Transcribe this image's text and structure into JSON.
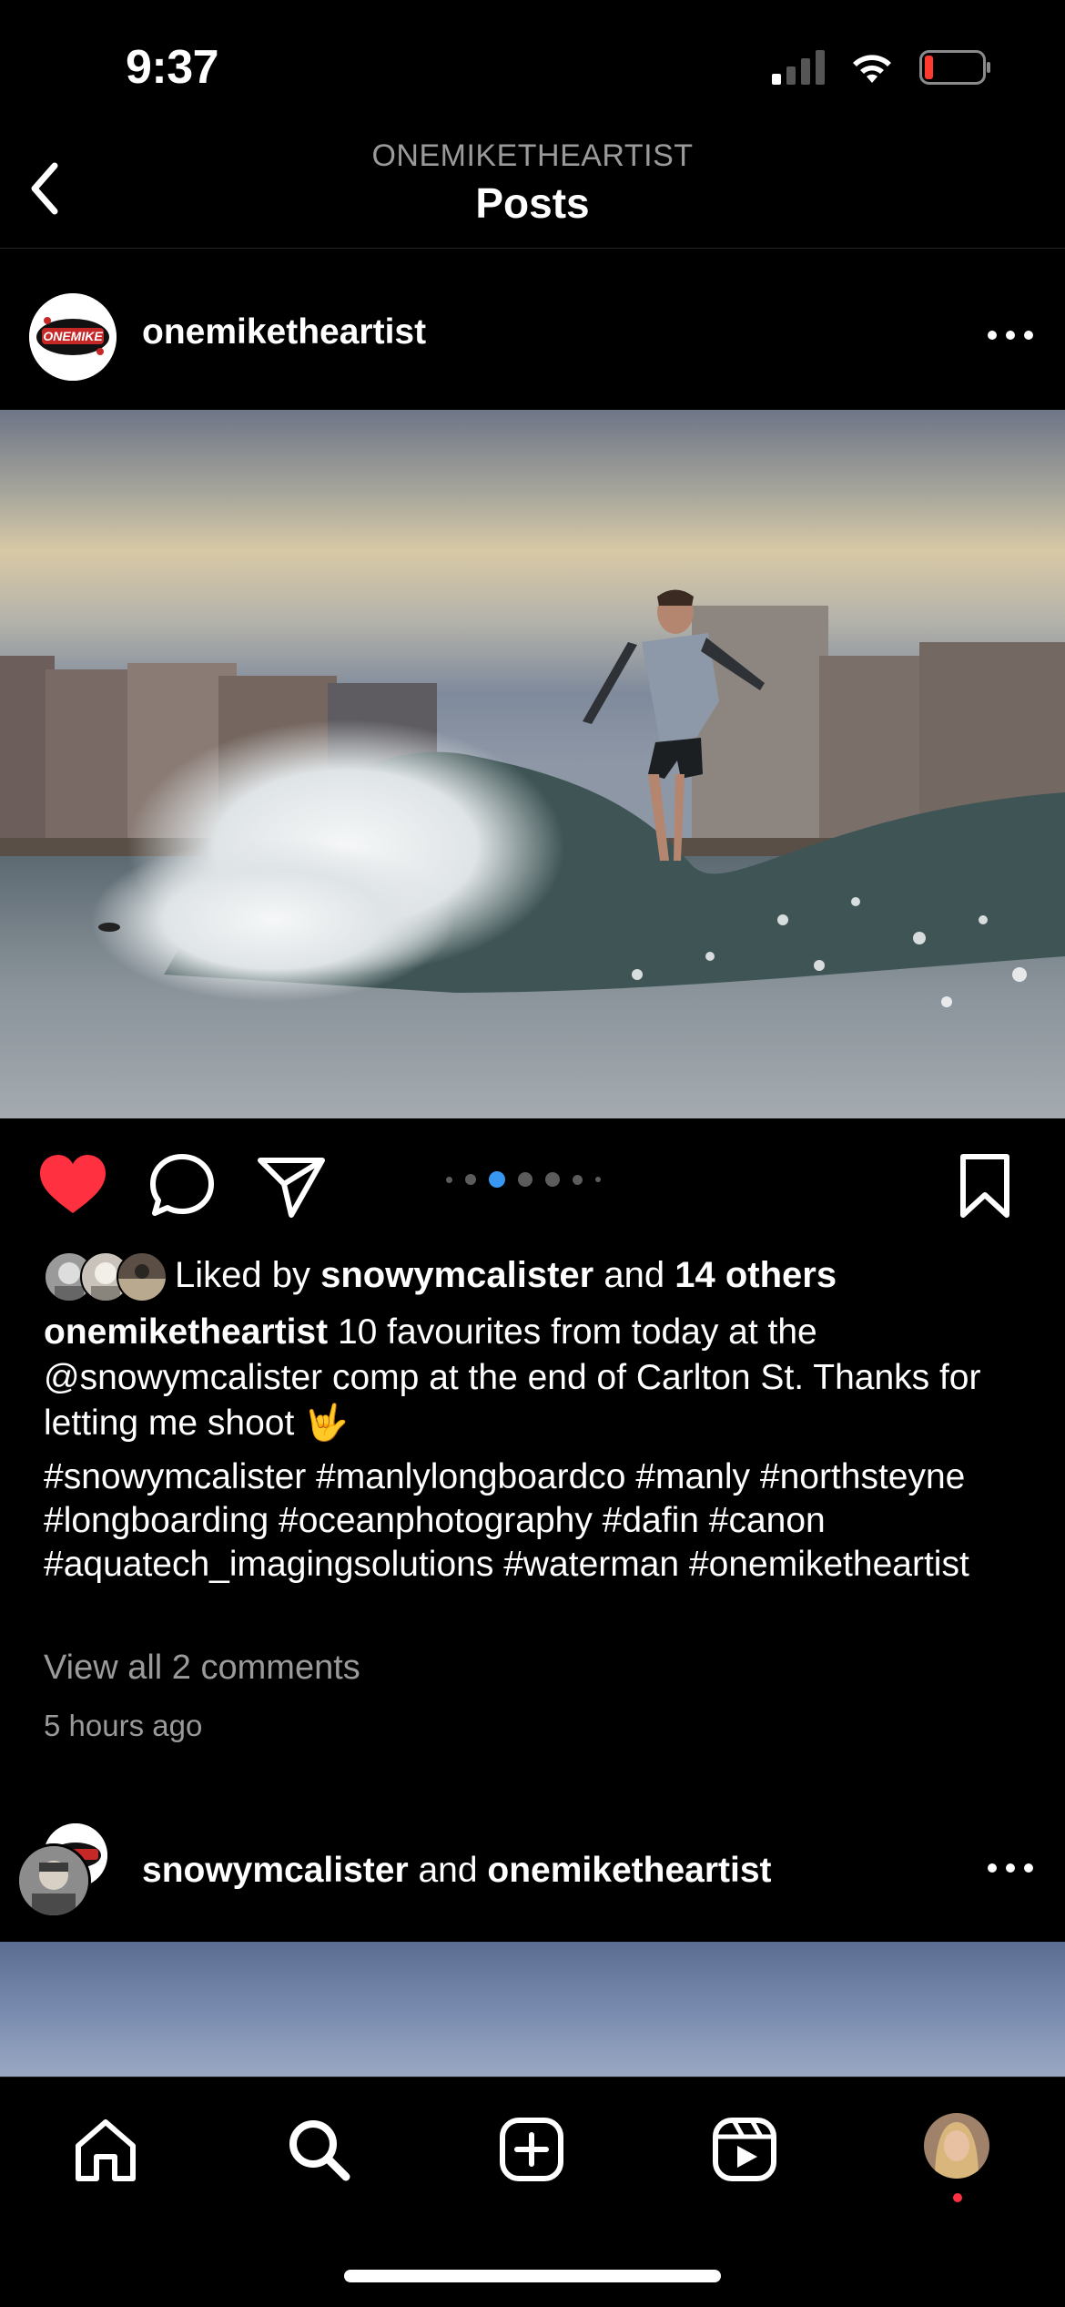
{
  "status_bar": {
    "time": "9:37"
  },
  "header": {
    "account": "ONEMIKETHEARTIST",
    "title": "Posts"
  },
  "post": {
    "username": "onemiketheartist",
    "carousel": {
      "count": 6,
      "active_index": 1
    },
    "likes": {
      "prefix": "Liked by",
      "liker": "snowymcalister",
      "connector": "and",
      "others": "14 others"
    },
    "caption": {
      "username": "onemiketheartist",
      "text": "10 favourites from today at the @snowymcalister comp at the end of Carlton St. Thanks for letting me shoot 🤟"
    },
    "hashtags": "#snowymcalister #manlylongboardco #manly #northsteyne #longboarding #oceanphotography #dafin #canon #aquatech_imagingsolutions #waterman #onemiketheartist",
    "view_comments": "View all 2 comments",
    "time_ago": "5 hours ago"
  },
  "next_post": {
    "user1": "snowymcalister",
    "connector": "and",
    "user2": "onemiketheartist"
  },
  "tab_bar": {
    "tabs": [
      "home",
      "search",
      "create",
      "reels",
      "profile"
    ]
  },
  "colors": {
    "like": "#ff3040",
    "active_dot": "#3897f0",
    "muted": "#9a9a9a"
  }
}
